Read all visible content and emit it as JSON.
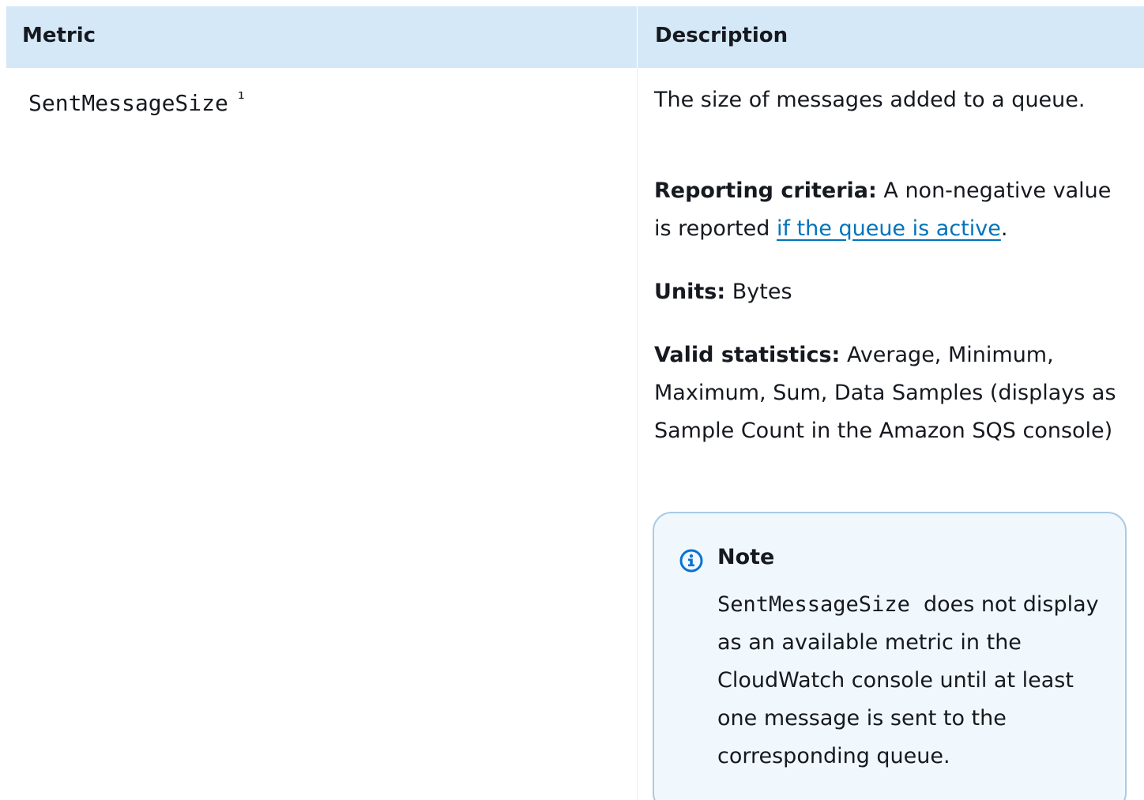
{
  "table": {
    "headers": {
      "metric": "Metric",
      "description": "Description"
    },
    "row": {
      "metric_name": "SentMessageSize",
      "metric_footnote": "¹",
      "description": {
        "summary": "The size of messages added to a queue.",
        "reporting_criteria": {
          "label": "Reporting criteria:",
          "text_before": "A non-negative value is reported",
          "link_text": "if the queue is active",
          "text_after": "."
        },
        "units": {
          "label": "Units:",
          "value": "Bytes"
        },
        "valid_statistics": {
          "label": "Valid statistics:",
          "value": "Average, Minimum, Maximum, Sum, Data Samples (displays as Sample Count in the Amazon SQS console)"
        },
        "note": {
          "icon": "info-icon",
          "title": "Note",
          "code": "SentMessageSize",
          "text": "does not display as an  available metric in the CloudWatch console until at least one  message is sent to the corresponding queue."
        }
      }
    }
  },
  "colors": {
    "header_bg": "#d5e8f8",
    "link": "#0073bb",
    "note_border": "#a9cbe7",
    "note_bg": "#f1f8fd",
    "info_icon": "#0972d3"
  }
}
